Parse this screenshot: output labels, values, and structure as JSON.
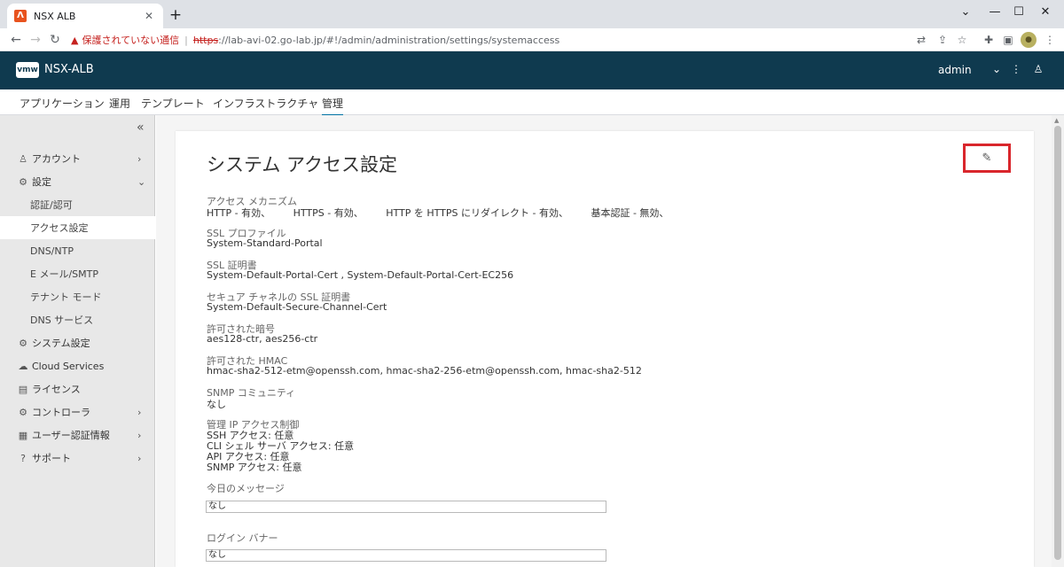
{
  "browser": {
    "tab_title": "NSX ALB",
    "tab_favicon": "Λ",
    "tab_close": "✕",
    "new_tab": "+",
    "security_warning": "保護されていない通信",
    "url_scheme": "https",
    "url_rest": "://lab-avi-02.go-lab.jp/#!/admin/administration/settings/systemaccess",
    "icons": [
      "back-icon",
      "forward-icon",
      "reload-icon",
      "translate-icon",
      "share-icon",
      "bookmark-star-icon",
      "extensions-icon",
      "sidepanel-icon",
      "profile-avatar-icon",
      "menu-kebab-icon"
    ]
  },
  "header": {
    "logo": "vmw",
    "app_name": "NSX-ALB",
    "user": "admin"
  },
  "top_nav": {
    "items": [
      "アプリケーション",
      "運用",
      "テンプレート",
      "インフラストラクチャ",
      "管理"
    ],
    "active": "管理"
  },
  "sidebar": {
    "items": [
      {
        "label": "アカウント",
        "icon": "account-icon"
      },
      {
        "label": "設定",
        "icon": "settings-icon"
      },
      {
        "label": "認証/認可"
      },
      {
        "label": "アクセス設定"
      },
      {
        "label": "DNS/NTP"
      },
      {
        "label": "E メール/SMTP"
      },
      {
        "label": "テナント モード"
      },
      {
        "label": "DNS サービス"
      },
      {
        "label": "システム設定",
        "icon": "system-settings-icon"
      },
      {
        "label": "Cloud Services",
        "icon": "cloud-services-icon"
      },
      {
        "label": "ライセンス",
        "icon": "license-icon"
      },
      {
        "label": "コントローラ",
        "icon": "controller-icon"
      },
      {
        "label": "ユーザー認証情報",
        "icon": "user-credentials-icon"
      },
      {
        "label": "サポート",
        "icon": "support-icon"
      }
    ],
    "active": "アクセス設定"
  },
  "main": {
    "title": "システム アクセス設定",
    "access_mechanism": {
      "label": "アクセス メカニズム",
      "values": [
        "HTTP - 有効、",
        "HTTPS - 有効、",
        "HTTP を HTTPS にリダイレクト - 有効、",
        "基本認証 - 無効、"
      ]
    },
    "ssl_profile": {
      "label": "SSL プロファイル",
      "value": "System-Standard-Portal"
    },
    "ssl_cert": {
      "label": "SSL 証明書",
      "value": "System-Default-Portal-Cert , System-Default-Portal-Cert-EC256"
    },
    "secure_channel_cert": {
      "label": "セキュア チャネルの SSL 証明書",
      "value": "System-Default-Secure-Channel-Cert"
    },
    "allowed_ciphers": {
      "label": "許可された暗号",
      "value": "aes128-ctr, aes256-ctr"
    },
    "allowed_hmac": {
      "label": "許可された HMAC",
      "value": "hmac-sha2-512-etm@openssh.com, hmac-sha2-256-etm@openssh.com, hmac-sha2-512"
    },
    "snmp_community": {
      "label": "SNMP コミュニティ",
      "value": "なし"
    },
    "mgmt_ip_access": {
      "label": "管理 IP アクセス制御",
      "lines": [
        "SSH アクセス: 任意",
        "CLI シェル サーバ アクセス: 任意",
        "API アクセス: 任意",
        "SNMP アクセス: 任意"
      ]
    },
    "motd": {
      "label": "今日のメッセージ",
      "value": "なし"
    },
    "login_banner": {
      "label": "ログイン バナー",
      "value": "なし"
    }
  }
}
